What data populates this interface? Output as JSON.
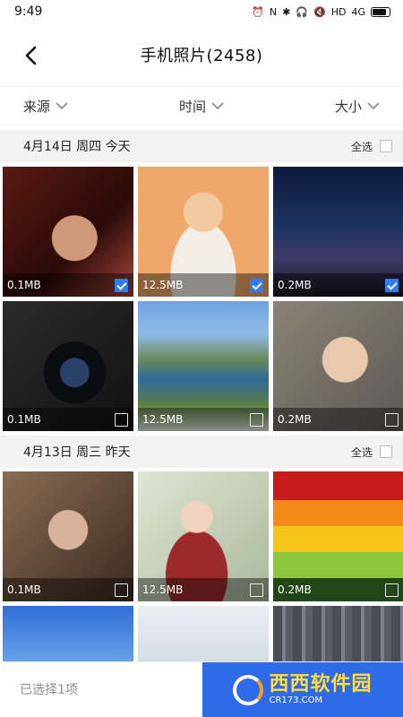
{
  "status": {
    "time": "9:49",
    "icons": [
      "alarm-icon",
      "nfc-icon",
      "bluetooth-icon",
      "headset-icon",
      "mute-icon",
      "wifi-icon",
      "hd-icon",
      "signal-icon",
      "battery-icon"
    ],
    "hd_label": "HD",
    "net_label": "4G"
  },
  "header": {
    "title": "手机照片(2458)"
  },
  "filters": [
    {
      "label": "来源"
    },
    {
      "label": "时间"
    },
    {
      "label": "大小"
    }
  ],
  "sections": [
    {
      "date": "4月14日 周四 今天",
      "select_all": "全选",
      "items": [
        {
          "size": "0.1MB",
          "checked": true
        },
        {
          "size": "12.5MB",
          "checked": true
        },
        {
          "size": "0.2MB",
          "checked": true
        },
        {
          "size": "0.1MB",
          "checked": false
        },
        {
          "size": "12.5MB",
          "checked": false
        },
        {
          "size": "0.2MB",
          "checked": false
        }
      ]
    },
    {
      "date": "4月13日 周三 昨天",
      "select_all": "全选",
      "items": [
        {
          "size": "0.1MB",
          "checked": false
        },
        {
          "size": "12.5MB",
          "checked": false
        },
        {
          "size": "0.2MB",
          "checked": false
        }
      ]
    }
  ],
  "footer": {
    "selected_text": "已选择1项",
    "watermark_main": "西西软件园",
    "watermark_sub": "CR173.COM"
  },
  "colors": {
    "accent": "#2f6ae8",
    "checkbox_checked": "#2f7cf6",
    "section_bg": "#f2f2f2"
  }
}
